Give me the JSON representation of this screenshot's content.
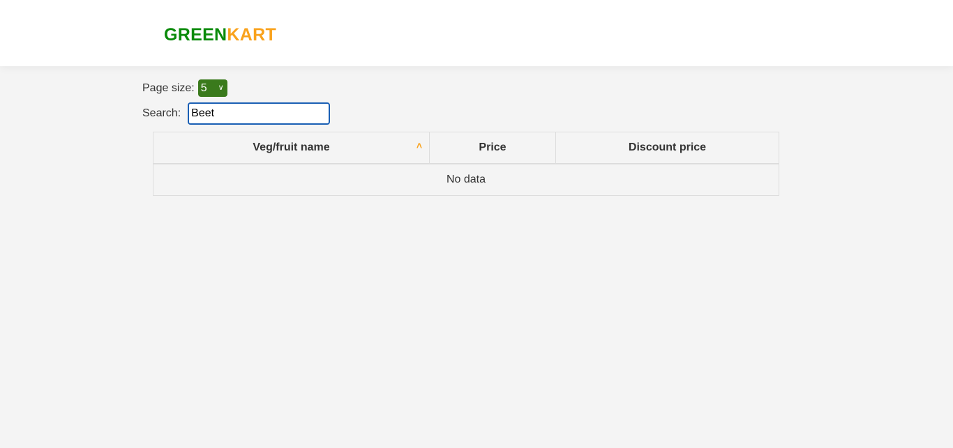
{
  "brand": {
    "part1": "GREEN",
    "part2": "KART",
    "color1": "#0a8a0a",
    "color2": "#f9a21c"
  },
  "pagesize": {
    "label": "Page size:",
    "selected": "5",
    "icon": "chevron-down-icon"
  },
  "search": {
    "label": "Search:",
    "value": "Beet"
  },
  "table": {
    "headers": [
      "Veg/fruit name",
      "Price",
      "Discount price"
    ],
    "sort_icon": "sort-ascending-icon",
    "empty_text": "No data"
  }
}
